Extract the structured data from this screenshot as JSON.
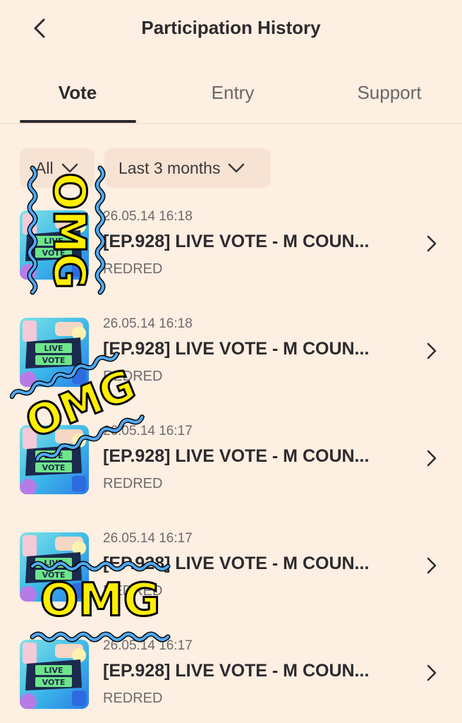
{
  "header": {
    "title": "Participation History",
    "back_icon": "chevron-left-icon"
  },
  "tabs": [
    {
      "label": "Vote",
      "active": true
    },
    {
      "label": "Entry",
      "active": false
    },
    {
      "label": "Support",
      "active": false
    }
  ],
  "filters": {
    "category": {
      "label": "All"
    },
    "period": {
      "label": "Last 3 months"
    }
  },
  "thumbnail_badge": {
    "line1": "LIVE",
    "line2": "VOTE"
  },
  "items": [
    {
      "date": "26.05.14 16:18",
      "title": "[EP.928] LIVE VOTE - M COUN...",
      "artist": "REDRED"
    },
    {
      "date": "26.05.14 16:18",
      "title": "[EP.928] LIVE VOTE - M COUN...",
      "artist": "REDRED"
    },
    {
      "date": "26.05.14 16:17",
      "title": "[EP.928] LIVE VOTE - M COUN...",
      "artist": "REDRED"
    },
    {
      "date": "26.05.14 16:17",
      "title": "[EP.928] LIVE VOTE - M COUN...",
      "artist": "REDRED"
    },
    {
      "date": "26.05.14 16:17",
      "title": "[EP.928] LIVE VOTE - M COUN...",
      "artist": "REDRED"
    }
  ],
  "stickers": [
    {
      "text": "OMG"
    },
    {
      "text": "OMG"
    },
    {
      "text": "OMG"
    }
  ],
  "colors": {
    "background": "#fdefe2",
    "filter_bg": "#f7e3d3",
    "text_primary": "#2d2a2e",
    "text_secondary": "#6e696b",
    "sticker_yellow": "#ffee00",
    "sticker_blue": "#4fa9f5"
  }
}
